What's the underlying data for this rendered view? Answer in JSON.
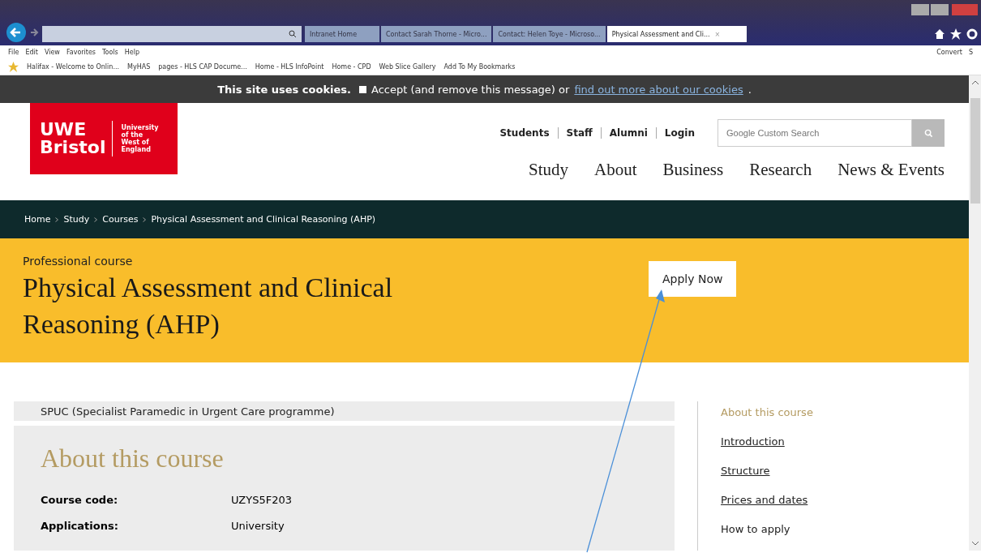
{
  "browser": {
    "tabs": [
      {
        "label": "Intranet Home",
        "selected": false
      },
      {
        "label": "Contact Sarah Thorne - Micro...",
        "selected": false
      },
      {
        "label": "Contact: Helen Toye - Microso...",
        "selected": false
      },
      {
        "label": "Physical Assessment and Cli...",
        "selected": true
      }
    ],
    "close_tab": "×",
    "menu": [
      "File",
      "Edit",
      "View",
      "Favorites",
      "Tools",
      "Help"
    ],
    "bookmarks": [
      "Halifax - Welcome to Onlin...",
      "MyHAS",
      "pages - HLS CAP Docume...",
      "Home - HLS InfoPoint",
      "Home - CPD",
      "Web Slice Gallery",
      "Add To My Bookmarks"
    ],
    "convert": "Convert",
    "right_cut": "S"
  },
  "cookie_bar": {
    "text": "This site uses cookies.",
    "checked": false,
    "accept": "Accept (and remove this message) or",
    "link": "find out more about our cookies",
    "end": "."
  },
  "header": {
    "logo_main": [
      "UWE",
      "Bristol"
    ],
    "logo_sub": [
      "University",
      "of the",
      "West of",
      "England"
    ],
    "utility_links": [
      "Students",
      "Staff",
      "Alumni",
      "Login"
    ],
    "search": {
      "placeholder": "Google Custom Search"
    },
    "nav": [
      "Study",
      "About",
      "Business",
      "Research",
      "News & Events"
    ]
  },
  "breadcrumb": [
    "Home",
    "Study",
    "Courses",
    "Physical Assessment and Clinical Reasoning (AHP)"
  ],
  "hero": {
    "eyebrow": "Professional course",
    "title": "Physical Assessment and Clinical Reasoning (AHP)",
    "button": "Apply Now"
  },
  "content": {
    "programme": "SPUC (Specialist Paramedic in Urgent Care programme)",
    "heading": "About this course",
    "facts": [
      {
        "label": "Course code:",
        "value": "UZYS5F203"
      },
      {
        "label": "Applications:",
        "value": "University"
      }
    ]
  },
  "side_nav": [
    {
      "label": "About this course",
      "selected": true
    },
    {
      "label": "Introduction",
      "selected": false
    },
    {
      "label": "Structure",
      "selected": false
    },
    {
      "label": "Prices and dates",
      "selected": false
    },
    {
      "label": "How to apply",
      "selected": false
    }
  ]
}
